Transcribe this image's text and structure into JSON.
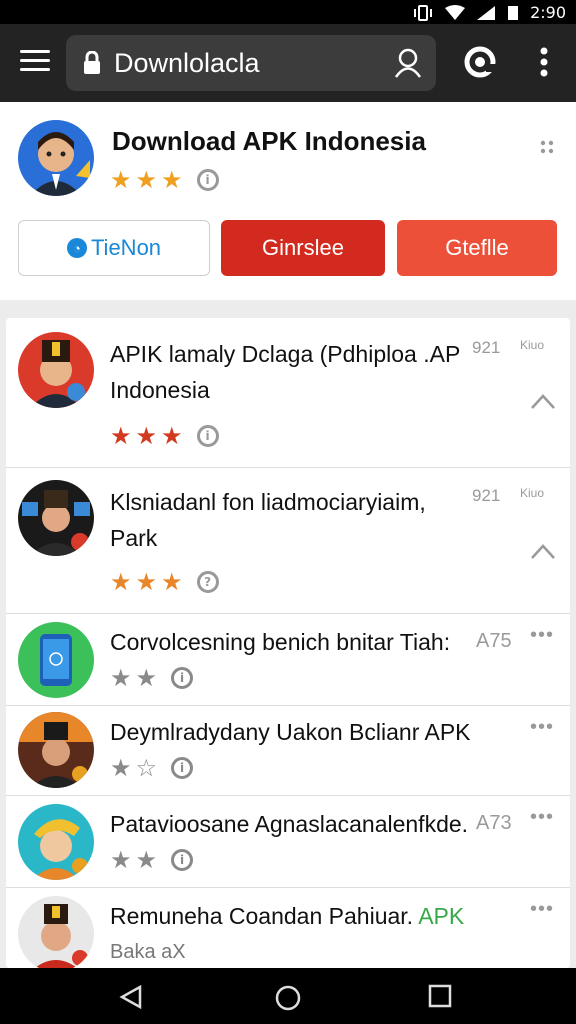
{
  "status_bar": {
    "time": "2:90"
  },
  "toolbar": {
    "url_text": "Downlolacla"
  },
  "header": {
    "app_title": "Download APK Indonesia",
    "rating_stars": 3,
    "buttons": [
      {
        "label": "TieNon",
        "icon": "circle-icon"
      },
      {
        "label": "Ginrslee"
      },
      {
        "label": "Gteflle"
      }
    ]
  },
  "list_items": [
    {
      "title_line1": "APIK lamaly Dclaga (Pdhiploa .AP",
      "title_line2": "Indonesia",
      "meta": "921",
      "meta2": "Kiuo",
      "stars": 3,
      "star_color": "#d23a20"
    },
    {
      "title_line1": "Klsniadanl fon liadmociaryiaim,",
      "title_line2": "Park",
      "meta": "921",
      "meta2": "Kiuo",
      "stars": 3,
      "star_color": "#e8862a"
    },
    {
      "title": "Corvolcesning benich bnitar Tiah:",
      "meta": "A75",
      "stars": 2
    },
    {
      "title": "Deymlradydany Uakon Bclianr APK",
      "stars": 2
    },
    {
      "title": "Patavioosane Agnaslacanalenfkde.",
      "meta": "A73",
      "stars": 2
    },
    {
      "title": "Remuneha Coandan Pahiuar.",
      "title_highlight": "APK",
      "subtitle": "Baka aX"
    }
  ],
  "colors": {
    "star_gold": "#f0a020",
    "star_gray": "#8a8a8a",
    "accent_red": "#d22a1e",
    "accent_red2": "#ec5038",
    "link_blue": "#1a88d8",
    "apk_green": "#3aa84a"
  }
}
